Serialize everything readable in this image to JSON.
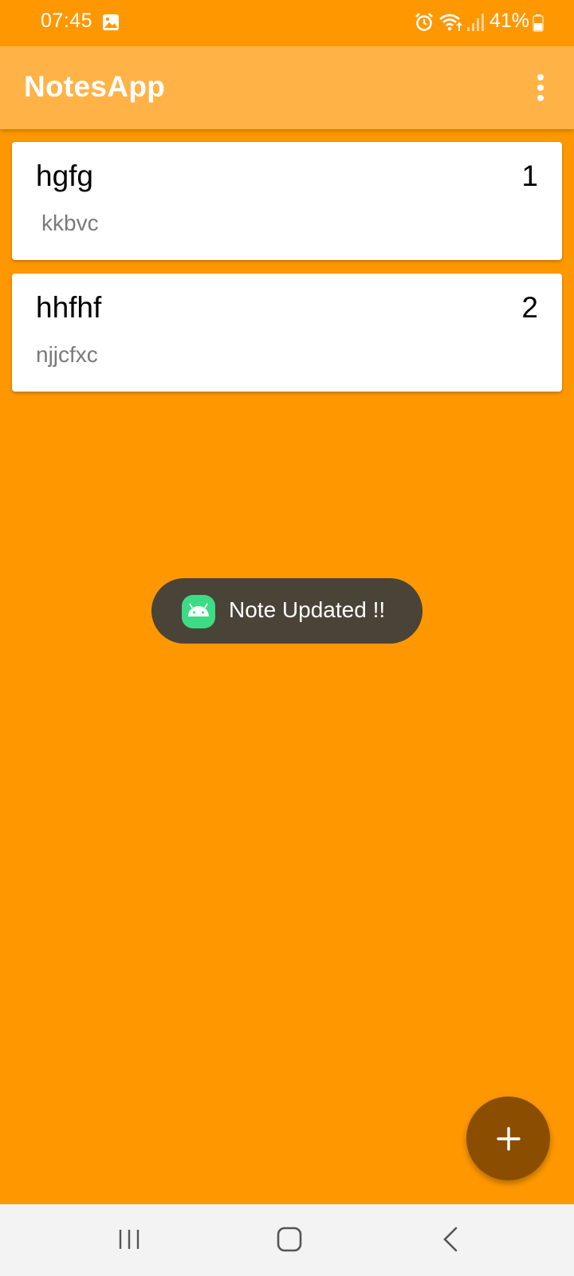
{
  "status_bar": {
    "time": "07:45",
    "battery": "41%",
    "icons": [
      "gallery-icon",
      "alarm-icon",
      "wifi-icon",
      "signal-icon",
      "battery-icon"
    ]
  },
  "app_bar": {
    "title": "NotesApp",
    "overflow_icon": "more-vert-icon"
  },
  "notes": [
    {
      "title": "hgfg",
      "number": "1",
      "body": "kkbvc"
    },
    {
      "title": "hhfhf",
      "number": "2",
      "body": "njjcfxc"
    }
  ],
  "toast": {
    "text": "Note Updated !!",
    "icon": "android-app-icon"
  },
  "fab": {
    "icon": "plus-icon"
  },
  "nav_bar": {
    "icons": [
      "recents-icon",
      "home-icon",
      "back-icon"
    ]
  },
  "colors": {
    "background": "#FF9800",
    "app_bar": "#FFB347",
    "fab": "#8B4E00",
    "toast": "#4a4337",
    "card": "#ffffff",
    "body_text": "#7a7a7a"
  }
}
